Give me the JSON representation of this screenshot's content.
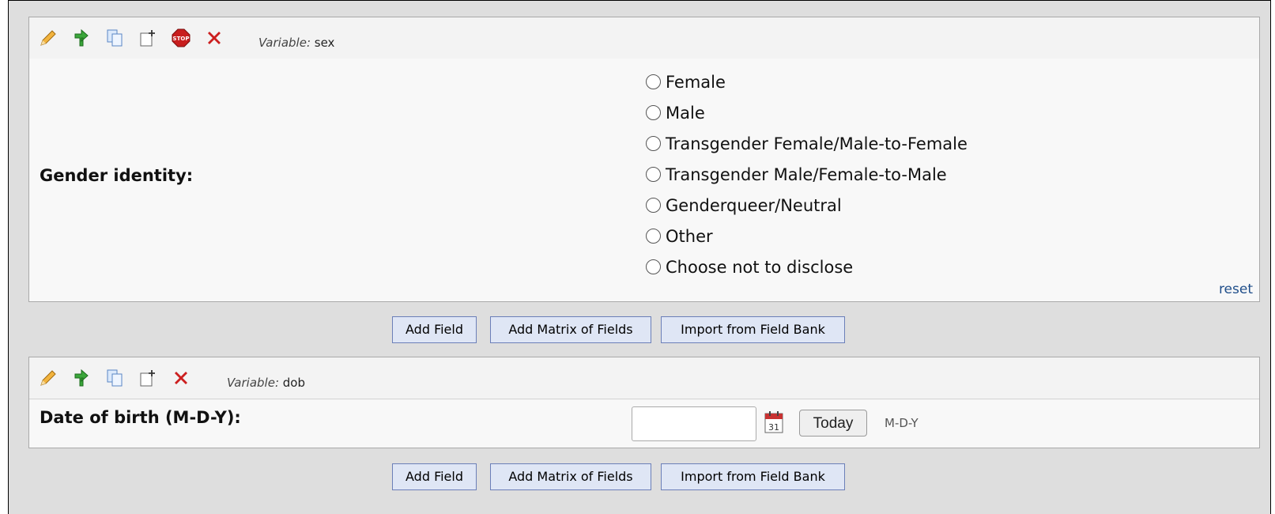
{
  "fields": [
    {
      "variable_prefix": "Variable:",
      "variable_name": "sex",
      "toolbar_icons": [
        "edit-pencil-icon",
        "branching-logic-icon",
        "copy-icon",
        "move-icon",
        "stop-action-icon",
        "delete-icon"
      ],
      "question": "Gender identity:",
      "choices": [
        "Female",
        "Male",
        "Transgender Female/Male-to-Female",
        "Transgender Male/Female-to-Male",
        "Genderqueer/Neutral",
        "Other",
        "Choose not to disclose"
      ],
      "reset_label": "reset"
    },
    {
      "variable_prefix": "Variable:",
      "variable_name": "dob",
      "toolbar_icons": [
        "edit-pencil-icon",
        "branching-logic-icon",
        "copy-icon",
        "move-icon",
        "delete-icon"
      ],
      "question": "Date of birth (M-D-Y):",
      "date_value": "",
      "today_label": "Today",
      "format_hint": "M-D-Y"
    }
  ],
  "buttons": {
    "add_field": "Add Field",
    "add_matrix": "Add Matrix of Fields",
    "import_field_bank": "Import from Field Bank"
  },
  "colors": {
    "panel_bg": "#dedede",
    "button_bg": "#dfe6f5",
    "button_border": "#6b7fb8",
    "link": "#1f4e8a"
  }
}
